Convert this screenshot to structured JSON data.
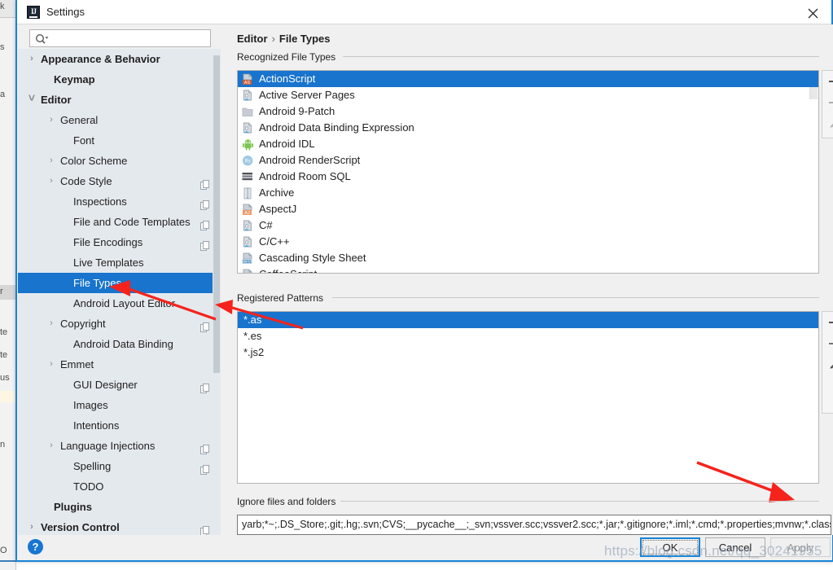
{
  "window": {
    "title": "Settings",
    "app_icon": "intellij-idea-icon",
    "close_icon": "close-icon"
  },
  "search": {
    "placeholder": "",
    "value": "",
    "icon": "search-icon"
  },
  "sidebar": {
    "items": [
      {
        "label": "Appearance & Behavior",
        "indent": 12,
        "chevron": "right",
        "bold": true,
        "badge": false,
        "selected": false
      },
      {
        "label": "Keymap",
        "indent": 28,
        "chevron": "",
        "bold": true,
        "badge": false,
        "selected": false
      },
      {
        "label": "Editor",
        "indent": 12,
        "chevron": "down",
        "bold": true,
        "badge": false,
        "selected": false
      },
      {
        "label": "General",
        "indent": 36,
        "chevron": "right",
        "bold": false,
        "badge": false,
        "selected": false
      },
      {
        "label": "Font",
        "indent": 52,
        "chevron": "",
        "bold": false,
        "badge": false,
        "selected": false
      },
      {
        "label": "Color Scheme",
        "indent": 36,
        "chevron": "right",
        "bold": false,
        "badge": false,
        "selected": false
      },
      {
        "label": "Code Style",
        "indent": 36,
        "chevron": "right",
        "bold": false,
        "badge": true,
        "selected": false
      },
      {
        "label": "Inspections",
        "indent": 52,
        "chevron": "",
        "bold": false,
        "badge": true,
        "selected": false
      },
      {
        "label": "File and Code Templates",
        "indent": 52,
        "chevron": "",
        "bold": false,
        "badge": true,
        "selected": false
      },
      {
        "label": "File Encodings",
        "indent": 52,
        "chevron": "",
        "bold": false,
        "badge": true,
        "selected": false
      },
      {
        "label": "Live Templates",
        "indent": 52,
        "chevron": "",
        "bold": false,
        "badge": false,
        "selected": false
      },
      {
        "label": "File Types",
        "indent": 52,
        "chevron": "",
        "bold": false,
        "badge": false,
        "selected": true
      },
      {
        "label": "Android Layout Editor",
        "indent": 52,
        "chevron": "",
        "bold": false,
        "badge": false,
        "selected": false
      },
      {
        "label": "Copyright",
        "indent": 36,
        "chevron": "right",
        "bold": false,
        "badge": true,
        "selected": false
      },
      {
        "label": "Android Data Binding",
        "indent": 52,
        "chevron": "",
        "bold": false,
        "badge": false,
        "selected": false
      },
      {
        "label": "Emmet",
        "indent": 36,
        "chevron": "right",
        "bold": false,
        "badge": false,
        "selected": false
      },
      {
        "label": "GUI Designer",
        "indent": 52,
        "chevron": "",
        "bold": false,
        "badge": true,
        "selected": false
      },
      {
        "label": "Images",
        "indent": 52,
        "chevron": "",
        "bold": false,
        "badge": false,
        "selected": false
      },
      {
        "label": "Intentions",
        "indent": 52,
        "chevron": "",
        "bold": false,
        "badge": false,
        "selected": false
      },
      {
        "label": "Language Injections",
        "indent": 36,
        "chevron": "right",
        "bold": false,
        "badge": true,
        "selected": false
      },
      {
        "label": "Spelling",
        "indent": 52,
        "chevron": "",
        "bold": false,
        "badge": true,
        "selected": false
      },
      {
        "label": "TODO",
        "indent": 52,
        "chevron": "",
        "bold": false,
        "badge": false,
        "selected": false
      },
      {
        "label": "Plugins",
        "indent": 28,
        "chevron": "",
        "bold": true,
        "badge": false,
        "selected": false
      },
      {
        "label": "Version Control",
        "indent": 12,
        "chevron": "right",
        "bold": true,
        "badge": true,
        "selected": false
      }
    ]
  },
  "content": {
    "breadcrumb": {
      "parent": "Editor",
      "separator": "›",
      "current": "File Types"
    },
    "recognized": {
      "group_label": "Recognized File Types",
      "rows": [
        {
          "label": "ActionScript",
          "icon": "actionscript-file-icon",
          "selected": true
        },
        {
          "label": "Active Server Pages",
          "icon": "generic-file-icon",
          "selected": false
        },
        {
          "label": "Android 9-Patch",
          "icon": "folder-icon",
          "selected": false
        },
        {
          "label": "Android Data Binding Expression",
          "icon": "generic-file-icon",
          "selected": false
        },
        {
          "label": "Android IDL",
          "icon": "android-robot-icon",
          "selected": false
        },
        {
          "label": "Android RenderScript",
          "icon": "renderscript-icon",
          "selected": false
        },
        {
          "label": "Android Room SQL",
          "icon": "database-table-icon",
          "selected": false
        },
        {
          "label": "Archive",
          "icon": "archive-zip-icon",
          "selected": false
        },
        {
          "label": "AspectJ",
          "icon": "aspectj-file-icon",
          "selected": false
        },
        {
          "label": "C#",
          "icon": "generic-file-icon",
          "selected": false
        },
        {
          "label": "C/C++",
          "icon": "generic-file-icon",
          "selected": false
        },
        {
          "label": "Cascading Style Sheet",
          "icon": "css-file-icon",
          "selected": false
        },
        {
          "label": "CoffeeScript",
          "icon": "coffeescript-file-icon",
          "selected": false
        }
      ],
      "add_label": "+",
      "remove_label": "−",
      "edit_label": "pencil"
    },
    "patterns": {
      "group_label": "Registered Patterns",
      "rows": [
        {
          "label": "*.as",
          "selected": true
        },
        {
          "label": "*.es",
          "selected": false
        },
        {
          "label": "*.js2",
          "selected": false
        }
      ]
    },
    "ignore": {
      "group_label": "Ignore files and folders",
      "value": "yarb;*~;.DS_Store;.git;.hg;.svn;CVS;__pycache__;_svn;vssver.scc;vssver2.scc;*.jar;*.gitignore;*.iml;*.cmd;*.properties;mvnw;*.class;"
    }
  },
  "footer": {
    "help_label": "?",
    "ok_label": "OK",
    "cancel_label": "Cancel",
    "apply_label": "Apply"
  },
  "watermark": {
    "text": "https://blog.csdn.net/qq_30241955"
  },
  "colors": {
    "accent": "#1874cd",
    "selection": "#1874cd",
    "border_focus": "#1884d6",
    "sidebar_bg": "#e4e9ee",
    "panel_bg": "#f0f0f0",
    "annotation_arrow": "#f5231c"
  }
}
